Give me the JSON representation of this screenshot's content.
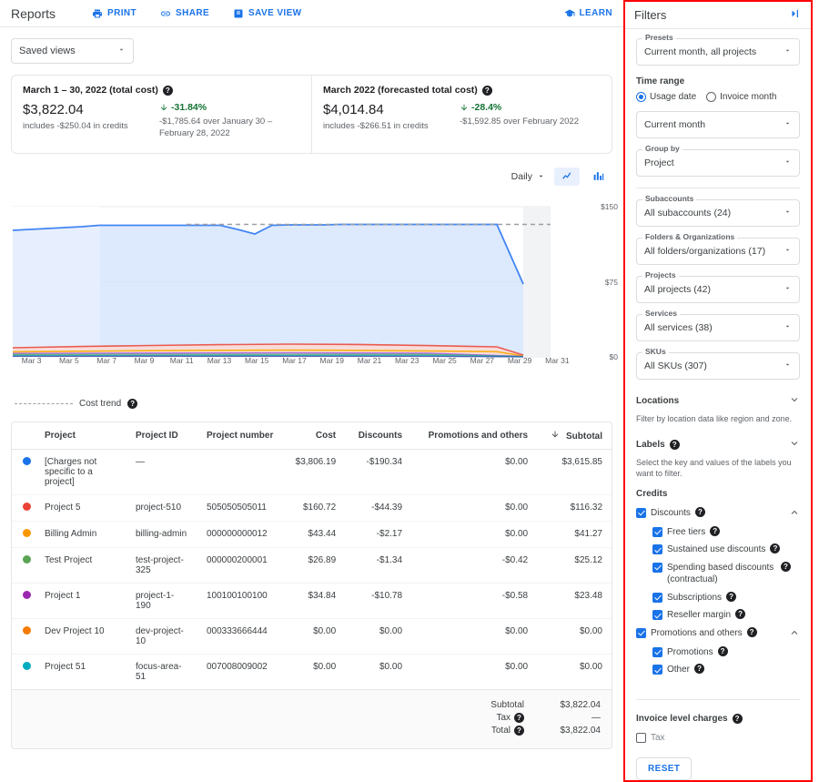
{
  "header": {
    "title": "Reports",
    "actions": [
      {
        "label": "PRINT",
        "icon": "print-icon"
      },
      {
        "label": "SHARE",
        "icon": "share-icon"
      },
      {
        "label": "SAVE VIEW",
        "icon": "save-view-icon"
      }
    ],
    "learn": {
      "label": "LEARN",
      "icon": "learn-icon"
    }
  },
  "saved_views": {
    "label": "Saved views"
  },
  "cards": [
    {
      "title": "March 1 – 30, 2022 (total cost)",
      "amount": "$3,822.04",
      "credits": "includes -$250.04 in credits",
      "delta": "-31.84%",
      "delta_direction": "down",
      "delta_sub": "-$1,785.64 over January 30 – February 28, 2022"
    },
    {
      "title": "March 2022 (forecasted total cost)",
      "amount": "$4,014.84",
      "credits": "includes -$266.51 in credits",
      "delta": "-28.4%",
      "delta_direction": "down",
      "delta_sub": "-$1,592.85 over February 2022"
    }
  ],
  "chart_tools": {
    "granularity": "Daily",
    "line_view": "line-chart-icon",
    "bar_view": "bar-chart-icon",
    "active_view": "line"
  },
  "chart_legend": {
    "label": "Cost trend"
  },
  "chart_data": {
    "type": "area",
    "title": "",
    "xlabel": "",
    "ylabel": "",
    "ylim": [
      0,
      150
    ],
    "ytick_labels": [
      "$0",
      "$75",
      "$150"
    ],
    "ytick_values": [
      0,
      75,
      150
    ],
    "grid": true,
    "legend_position": "below",
    "x": [
      "Mar 1",
      "Mar 2",
      "Mar 3",
      "Mar 4",
      "Mar 5",
      "Mar 6",
      "Mar 7",
      "Mar 8",
      "Mar 9",
      "Mar 10",
      "Mar 11",
      "Mar 12",
      "Mar 13",
      "Mar 14",
      "Mar 15",
      "Mar 16",
      "Mar 17",
      "Mar 18",
      "Mar 19",
      "Mar 20",
      "Mar 21",
      "Mar 22",
      "Mar 23",
      "Mar 24",
      "Mar 25",
      "Mar 26",
      "Mar 27",
      "Mar 28",
      "Mar 29",
      "Mar 30",
      "Mar 31"
    ],
    "xtick_labels": [
      "Mar 3",
      "Mar 5",
      "Mar 7",
      "Mar 9",
      "Mar 11",
      "Mar 13",
      "Mar 15",
      "Mar 17",
      "Mar 19",
      "Mar 21",
      "Mar 23",
      "Mar 25",
      "Mar 27",
      "Mar 29",
      "Mar 31"
    ],
    "series": [
      {
        "name": "[Charges not specific to a project]",
        "color": "#4285f4",
        "values": [
          126,
          126.5,
          127,
          127.5,
          128,
          129,
          129,
          129,
          129,
          129,
          129,
          129,
          129,
          125,
          121,
          128,
          128.5,
          128.5,
          128.5,
          129,
          129,
          129,
          129,
          129,
          129,
          129,
          129,
          129,
          129,
          70,
          0
        ]
      },
      {
        "name": "Project 5",
        "color": "#ea4335",
        "values": [
          6.2,
          6.3,
          6.4,
          6.5,
          6.6,
          6.8,
          6.9,
          7.0,
          7.0,
          7.1,
          7.2,
          7.3,
          7.4,
          7.5,
          7.6,
          7.6,
          7.5,
          7.4,
          7.3,
          7.2,
          7.1,
          7.0,
          6.8,
          6.6,
          6.4,
          6.3,
          6.2,
          6.1,
          6.0,
          2.5,
          0
        ]
      },
      {
        "name": "Billing Admin",
        "color": "#fbbc04",
        "values": [
          1.5,
          1.5,
          1.5,
          1.5,
          1.5,
          1.5,
          1.5,
          1.5,
          1.5,
          1.5,
          1.5,
          1.5,
          1.5,
          1.5,
          1.5,
          1.5,
          1.5,
          1.5,
          1.5,
          1.5,
          1.5,
          1.5,
          1.5,
          1.5,
          1.5,
          1.5,
          1.5,
          1.5,
          1.5,
          0.8,
          0
        ]
      },
      {
        "name": "Test Project",
        "color": "#34a853",
        "values": [
          0.9,
          0.9,
          0.9,
          0.9,
          0.9,
          0.9,
          0.9,
          0.9,
          0.9,
          0.9,
          0.9,
          0.9,
          0.9,
          0.9,
          0.9,
          0.9,
          0.9,
          0.9,
          0.9,
          0.9,
          0.9,
          0.9,
          0.9,
          0.9,
          0.9,
          0.9,
          0.9,
          0.9,
          0.9,
          0.5,
          0
        ]
      },
      {
        "name": "Project 1",
        "color": "#a142f4",
        "values": [
          1.1,
          1.1,
          1.1,
          1.1,
          1.1,
          1.1,
          1.1,
          1.1,
          1.1,
          1.1,
          1.1,
          1.1,
          1.1,
          1.1,
          1.1,
          1.1,
          1.1,
          1.1,
          1.1,
          1.1,
          1.1,
          1.1,
          1.1,
          1.1,
          1.1,
          1.1,
          1.1,
          1.1,
          1.1,
          0.6,
          0
        ]
      }
    ],
    "trend_line": {
      "name": "Cost trend",
      "style": "dashed",
      "color": "#9aa0a6",
      "values": [
        129,
        129,
        129,
        129,
        129,
        129,
        129,
        129,
        129,
        129,
        129,
        129,
        129,
        129,
        129,
        129,
        129,
        129,
        129,
        129,
        129,
        129,
        129,
        129,
        129,
        129,
        129,
        129,
        129,
        129,
        129
      ]
    },
    "forecast_region_start": "Mar 30"
  },
  "table": {
    "columns": [
      {
        "label": "Project",
        "align": "left"
      },
      {
        "label": "Project ID",
        "align": "left"
      },
      {
        "label": "Project number",
        "align": "left"
      },
      {
        "label": "Cost",
        "align": "right"
      },
      {
        "label": "Discounts",
        "align": "right"
      },
      {
        "label": "Promotions and others",
        "align": "right"
      },
      {
        "label": "Subtotal",
        "align": "right",
        "sorted": true,
        "sort_icon": "arrow-down-icon"
      }
    ],
    "rows": [
      {
        "color": "#1a73e8",
        "project": "[Charges not specific to a project]",
        "project_id": "—",
        "project_number": "",
        "cost": "$3,806.19",
        "discounts": "-$190.34",
        "promotions": "$0.00",
        "subtotal": "$3,615.85"
      },
      {
        "color": "#ea4335",
        "project": "Project 5",
        "project_id": "project-510",
        "project_number": "505050505011",
        "cost": "$160.72",
        "discounts": "-$44.39",
        "promotions": "$0.00",
        "subtotal": "$116.32"
      },
      {
        "color": "#fa9800",
        "project": "Billing Admin",
        "project_id": "billing-admin",
        "project_number": "000000000012",
        "cost": "$43.44",
        "discounts": "-$2.17",
        "promotions": "$0.00",
        "subtotal": "$41.27"
      },
      {
        "color": "#5aa454",
        "project": "Test Project",
        "project_id": "test-project-325",
        "project_number": "000000200001",
        "cost": "$26.89",
        "discounts": "-$1.34",
        "promotions": "-$0.42",
        "subtotal": "$25.12"
      },
      {
        "color": "#9c27b0",
        "project": "Project 1",
        "project_id": "project-1-190",
        "project_number": "100100100100",
        "cost": "$34.84",
        "discounts": "-$10.78",
        "promotions": "-$0.58",
        "subtotal": "$23.48"
      },
      {
        "color": "#f57c00",
        "project": "Dev Project 10",
        "project_id": "dev-project-10",
        "project_number": "000333666444",
        "cost": "$0.00",
        "discounts": "$0.00",
        "promotions": "$0.00",
        "subtotal": "$0.00"
      },
      {
        "color": "#00acc1",
        "project": "Project 51",
        "project_id": "focus-area-51",
        "project_number": "007008009002",
        "cost": "$0.00",
        "discounts": "$0.00",
        "promotions": "$0.00",
        "subtotal": "$0.00"
      }
    ],
    "totals": [
      {
        "label": "Subtotal",
        "value": "$3,822.04",
        "help": false
      },
      {
        "label": "Tax",
        "value": "—",
        "help": true
      },
      {
        "label": "Total",
        "value": "$3,822.04",
        "help": true
      }
    ]
  },
  "filters": {
    "title": "Filters",
    "collapse_icon": "collapse-panel-icon",
    "presets": {
      "label": "Presets",
      "value": "Current month, all projects"
    },
    "time_range": {
      "label": "Time range",
      "options": [
        {
          "label": "Usage date",
          "selected": true
        },
        {
          "label": "Invoice month",
          "selected": false
        }
      ],
      "value": "Current month"
    },
    "group_by": {
      "label": "Group by",
      "value": "Project"
    },
    "subaccounts": {
      "label": "Subaccounts",
      "value": "All subaccounts (24)"
    },
    "folders": {
      "label": "Folders & Organizations",
      "value": "All folders/organizations (17)"
    },
    "projects": {
      "label": "Projects",
      "value": "All projects (42)"
    },
    "services": {
      "label": "Services",
      "value": "All services (38)"
    },
    "skus": {
      "label": "SKUs",
      "value": "All SKUs (307)"
    },
    "locations": {
      "label": "Locations",
      "description": "Filter by location data like region and zone.",
      "expanded": false
    },
    "labels": {
      "label": "Labels",
      "description": "Select the key and values of the labels you want to filter.",
      "expanded": false,
      "help": true
    },
    "credits": {
      "label": "Credits",
      "groups": [
        {
          "label": "Discounts",
          "checked": true,
          "help": true,
          "expanded": true,
          "items": [
            {
              "label": "Free tiers",
              "checked": true,
              "help": true
            },
            {
              "label": "Sustained use discounts",
              "checked": true,
              "help": true
            },
            {
              "label": "Spending based discounts (contractual)",
              "checked": true,
              "help": true
            },
            {
              "label": "Subscriptions",
              "checked": true,
              "help": true
            },
            {
              "label": "Reseller margin",
              "checked": true,
              "help": true
            }
          ]
        },
        {
          "label": "Promotions and others",
          "checked": true,
          "help": true,
          "expanded": true,
          "items": [
            {
              "label": "Promotions",
              "checked": true,
              "help": true
            },
            {
              "label": "Other",
              "checked": true,
              "help": true
            }
          ]
        }
      ]
    },
    "invoice_level_charges": {
      "label": "Invoice level charges",
      "help": true,
      "items": [
        {
          "label": "Tax",
          "checked": false
        }
      ]
    },
    "reset": {
      "label": "RESET"
    }
  }
}
